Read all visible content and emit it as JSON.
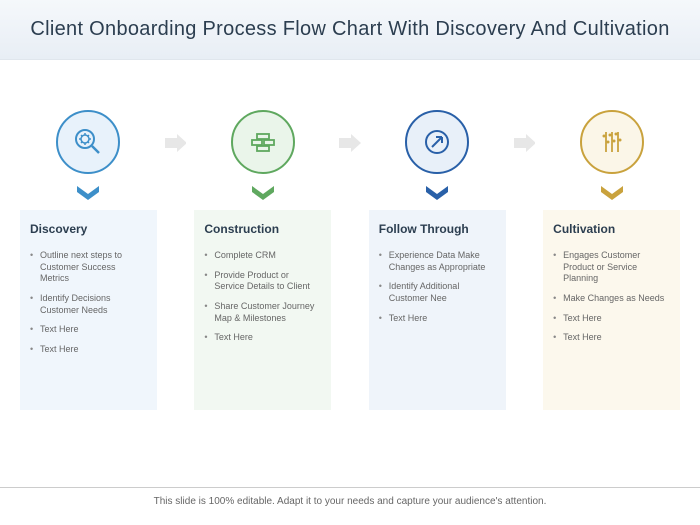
{
  "title": "Client Onboarding Process Flow Chart With Discovery And Cultivation",
  "footer": "This slide is 100% editable. Adapt it to your needs and capture your audience's attention.",
  "stages": [
    {
      "name": "Discovery",
      "icon": "magnify-gear-icon",
      "color": "#3d8fc9",
      "items": [
        "Outline next steps to Customer Success Metrics",
        "Identify Decisions Customer Needs",
        "Text Here",
        "Text Here"
      ]
    },
    {
      "name": "Construction",
      "icon": "bricks-icon",
      "color": "#5fa85f",
      "items": [
        "Complete CRM",
        "Provide Product or Service Details to Client",
        "Share Customer Journey Map & Milestones",
        "Text Here"
      ]
    },
    {
      "name": "Follow Through",
      "icon": "arrow-up-circle-icon",
      "color": "#2960a8",
      "items": [
        "Experience Data Make Changes as Appropriate",
        "Identify Additional Customer Nee",
        "Text Here"
      ]
    },
    {
      "name": "Cultivation",
      "icon": "growth-icon",
      "color": "#c9a23d",
      "items": [
        "Engages Customer Product or Service Planning",
        "Make Changes as Needs",
        "Text Here",
        "Text Here"
      ]
    }
  ]
}
